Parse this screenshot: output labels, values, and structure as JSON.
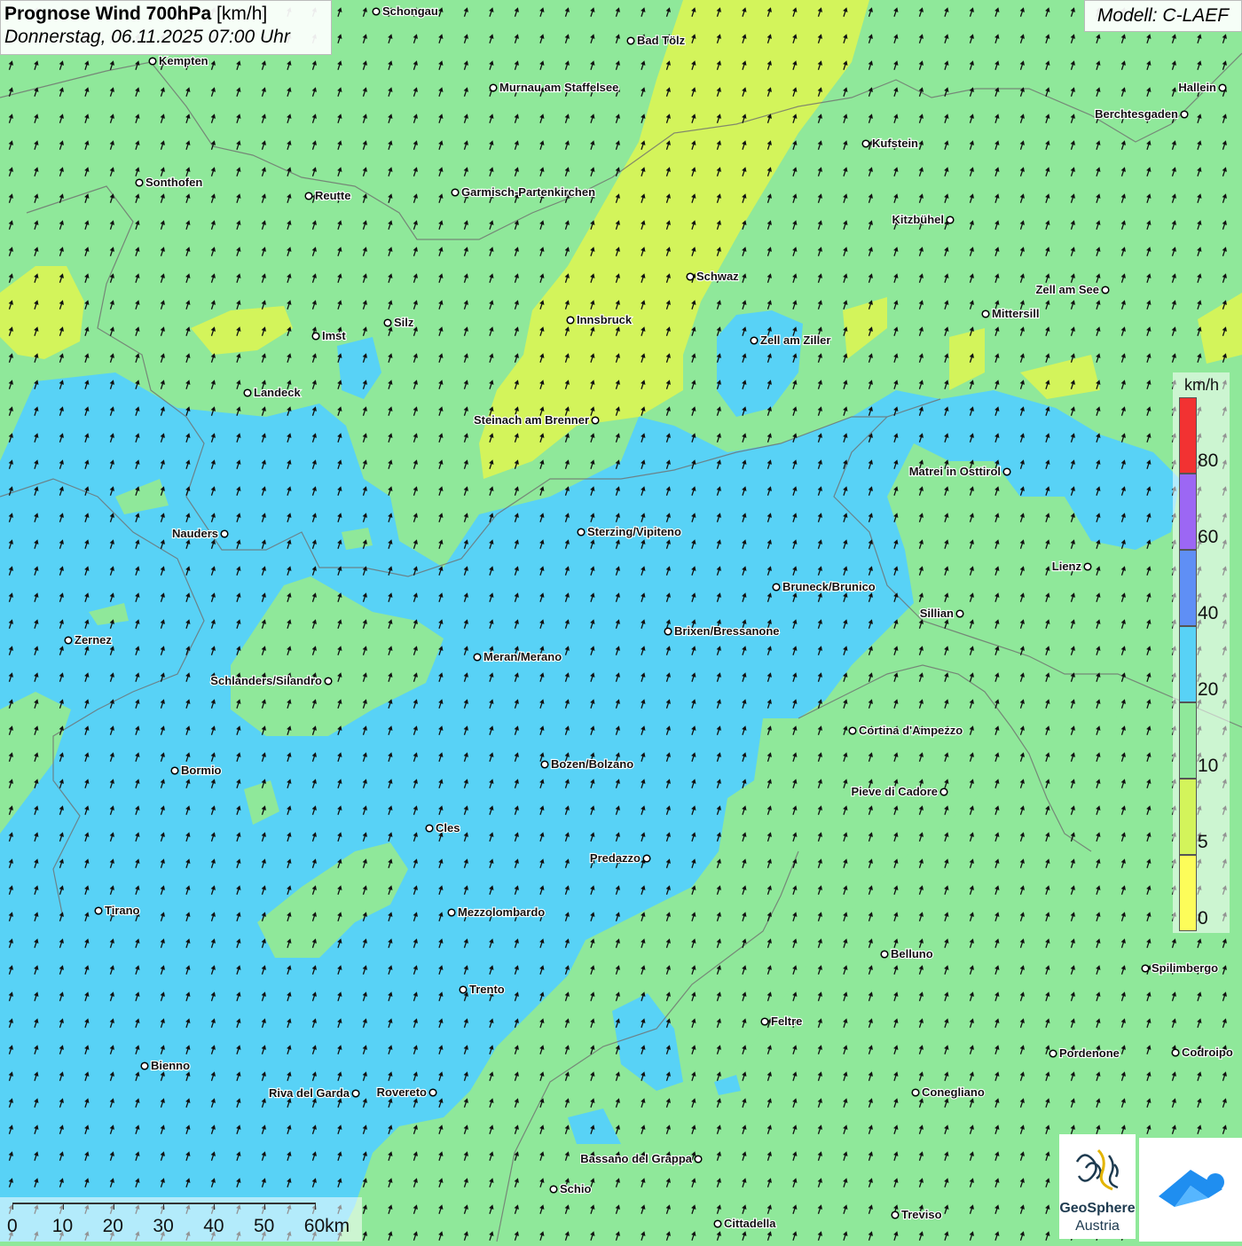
{
  "header": {
    "title_bold": "Prognose Wind 700hPa",
    "title_unit": "[km/h]",
    "datetime": "Donnerstag, 06.11.2025 07:00 Uhr",
    "model": "Modell: C-LAEF"
  },
  "legend": {
    "unit": "km/h",
    "ticks": [
      "0",
      "5",
      "10",
      "20",
      "40",
      "60",
      "80"
    ],
    "colors": [
      "#fdfd5a",
      "#d3f45b",
      "#8fe89a",
      "#58d2f6",
      "#5f8ff5",
      "#9c67f4",
      "#f23232"
    ]
  },
  "scale": {
    "labels": [
      "0",
      "10",
      "20",
      "30",
      "40",
      "50",
      "60km"
    ]
  },
  "logos": {
    "geosphere_line1": "GeoSphere",
    "geosphere_line2": "Austria",
    "geosphere_icon": "geosphere-logo-icon",
    "app_icon": "cloud-arrow-icon"
  },
  "map": {
    "wind_arrow_direction": "north-northeast",
    "zone_colors": {
      "low": "#d3f45b",
      "mid": "#8fe89a",
      "high": "#58d2f6"
    },
    "cities": [
      {
        "name": "Schongau"
      },
      {
        "name": "Bad Tölz"
      },
      {
        "name": "Kempten"
      },
      {
        "name": "Murnau am Staffelsee"
      },
      {
        "name": "Hallein"
      },
      {
        "name": "Berchtesgaden"
      },
      {
        "name": "Kufstein"
      },
      {
        "name": "Sonthofen"
      },
      {
        "name": "Reutte"
      },
      {
        "name": "Garmisch-Partenkirchen"
      },
      {
        "name": "Kitzbühel"
      },
      {
        "name": "Schwaz"
      },
      {
        "name": "Zell am See"
      },
      {
        "name": "Mittersill"
      },
      {
        "name": "Imst"
      },
      {
        "name": "Silz"
      },
      {
        "name": "Innsbruck"
      },
      {
        "name": "Zell am Ziller"
      },
      {
        "name": "Landeck"
      },
      {
        "name": "Steinach am Brenner"
      },
      {
        "name": "Matrei in Osttirol"
      },
      {
        "name": "Nauders"
      },
      {
        "name": "Sterzing/Vipiteno"
      },
      {
        "name": "Lienz"
      },
      {
        "name": "Bruneck/Brunico"
      },
      {
        "name": "Sillian"
      },
      {
        "name": "Brixen/Bressanone"
      },
      {
        "name": "Zernez"
      },
      {
        "name": "Meran/Merano"
      },
      {
        "name": "Schlanders/Silandro"
      },
      {
        "name": "Cortina d'Ampezzo"
      },
      {
        "name": "Bozen/Bolzano"
      },
      {
        "name": "Bormio"
      },
      {
        "name": "Pieve di Cadore"
      },
      {
        "name": "Cles"
      },
      {
        "name": "Predazzo"
      },
      {
        "name": "Tirano"
      },
      {
        "name": "Mezzolombardo"
      },
      {
        "name": "Belluno"
      },
      {
        "name": "Spilimbergo"
      },
      {
        "name": "Trento"
      },
      {
        "name": "Feltre"
      },
      {
        "name": "Bienno"
      },
      {
        "name": "Pordenone"
      },
      {
        "name": "Codroipo"
      },
      {
        "name": "Riva del Garda"
      },
      {
        "name": "Rovereto"
      },
      {
        "name": "Conegliano"
      },
      {
        "name": "Bassano del Grappa"
      },
      {
        "name": "Schio"
      },
      {
        "name": "Treviso"
      },
      {
        "name": "Cittadella"
      }
    ]
  }
}
